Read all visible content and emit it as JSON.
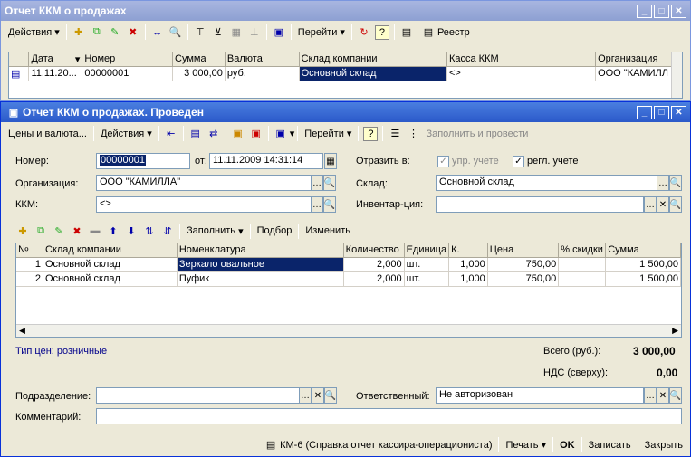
{
  "back_window": {
    "title": "Отчет ККМ о продажах",
    "toolbar": {
      "actions": "Действия",
      "goto": "Перейти",
      "registry": "Реестр"
    },
    "columns": [
      "Дата",
      "Номер",
      "Сумма",
      "Валюта",
      "Склад компании",
      "Касса ККМ",
      "Организация"
    ],
    "row": {
      "date": "11.11.20...",
      "number": "00000001",
      "sum": "3 000,00",
      "currency": "руб.",
      "warehouse": "Основной склад",
      "register": "<>",
      "org": "ООО \"КАМИЛЛ"
    }
  },
  "doc_window": {
    "title": "Отчет ККМ о продажах. Проведен",
    "toolbar": {
      "prices": "Цены и валюта...",
      "actions": "Действия",
      "goto": "Перейти",
      "fill_post": "Заполнить и провести"
    },
    "form": {
      "number_label": "Номер:",
      "number_value": "00000001",
      "from_label": "от:",
      "date_value": "11.11.2009 14:31:14",
      "reflect_label": "Отразить в:",
      "mgmt_label": "упр. учете",
      "reg_label": "регл. учете",
      "org_label": "Организация:",
      "org_value": "ООО \"КАМИЛЛА\"",
      "warehouse_label": "Склад:",
      "warehouse_value": "Основной склад",
      "kkm_label": "ККМ:",
      "kkm_value": "<>",
      "inventory_label": "Инвентар-ция:",
      "inventory_value": ""
    },
    "table_toolbar": {
      "fill": "Заполнить",
      "select": "Подбор",
      "change": "Изменить"
    },
    "table": {
      "columns": [
        "№",
        "Склад компании",
        "Номенклатура",
        "Количество",
        "Единица",
        "К.",
        "Цена",
        "% скидки",
        "Сумма"
      ],
      "rows": [
        {
          "n": "1",
          "wh": "Основной склад",
          "item": "Зеркало овальное",
          "qty": "2,000",
          "unit": "шт.",
          "k": "1,000",
          "price": "750,00",
          "disc": "",
          "sum": "1 500,00"
        },
        {
          "n": "2",
          "wh": "Основной склад",
          "item": "Пуфик",
          "qty": "2,000",
          "unit": "шт.",
          "k": "1,000",
          "price": "750,00",
          "disc": "",
          "sum": "1 500,00"
        }
      ]
    },
    "price_type": "Тип цен: розничные",
    "total_label": "Всего (руб.):",
    "total_value": "3 000,00",
    "vat_label": "НДС (сверху):",
    "vat_value": "0,00",
    "dept_label": "Подразделение:",
    "dept_value": "",
    "resp_label": "Ответственный:",
    "resp_value": "Не авторизован",
    "comment_label": "Комментарий:",
    "comment_value": "",
    "bottom": {
      "km6": "КМ-6 (Справка отчет кассира-операциониста)",
      "print": "Печать",
      "ok": "OK",
      "save": "Записать",
      "close": "Закрыть"
    }
  }
}
